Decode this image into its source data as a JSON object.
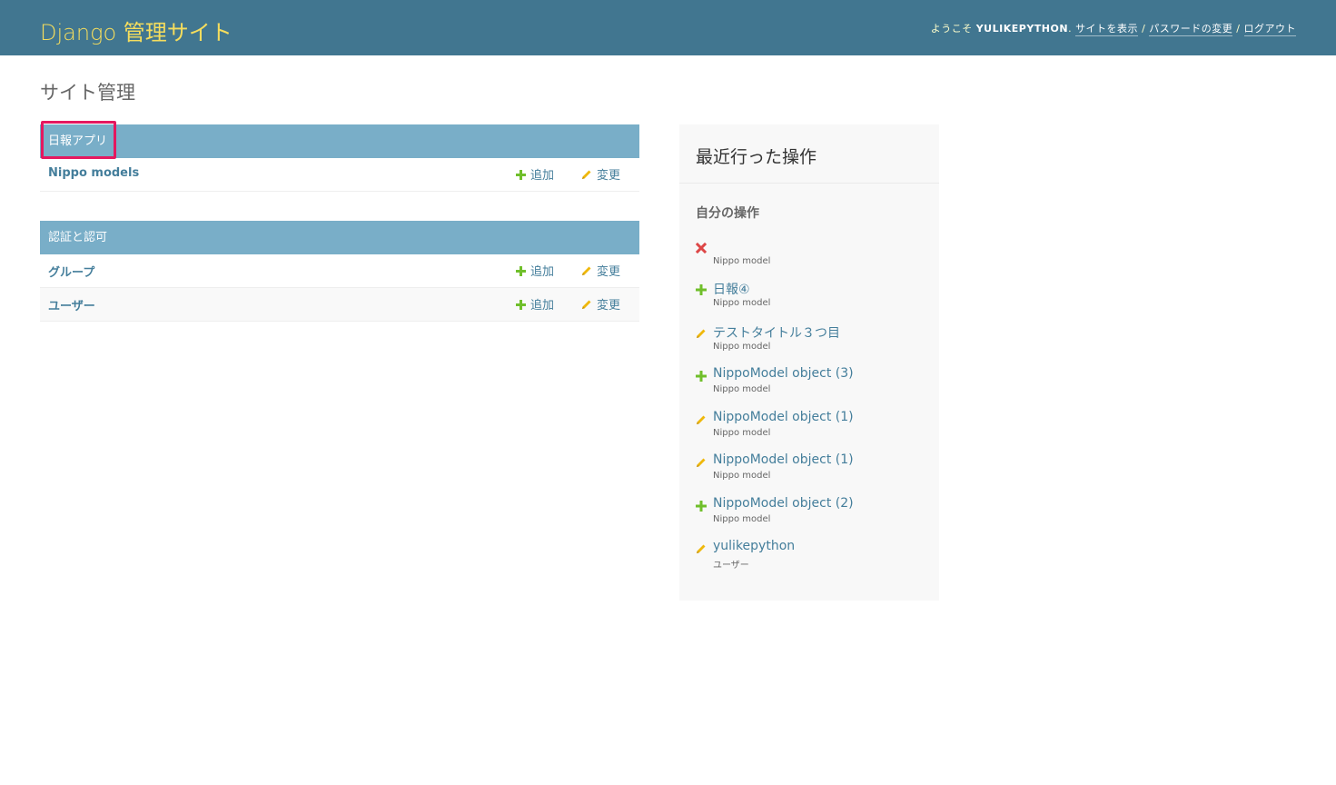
{
  "header": {
    "branding": "Django 管理サイト",
    "welcome": "ようこそ",
    "username": "YULIKEPYTHON",
    "view_site": "サイトを表示",
    "change_password": "パスワードの変更",
    "logout": "ログアウト",
    "separator": "/"
  },
  "page_title": "サイト管理",
  "apps": [
    {
      "caption": "日報アプリ",
      "models": [
        {
          "name": "Nippo models",
          "add": "追加",
          "change": "変更"
        }
      ]
    },
    {
      "caption": "認証と認可",
      "models": [
        {
          "name": "グループ",
          "add": "追加",
          "change": "変更"
        },
        {
          "name": "ユーザー",
          "add": "追加",
          "change": "変更"
        }
      ]
    }
  ],
  "recent_actions": {
    "title": "最近行った操作",
    "subtitle": "自分の操作",
    "items": [
      {
        "icon": "delete-icon",
        "label": "",
        "type": "Nippo model"
      },
      {
        "icon": "add-icon",
        "label": "日報④",
        "type": "Nippo model"
      },
      {
        "icon": "edit-icon",
        "label": "テストタイトル３つ目",
        "type": "Nippo model"
      },
      {
        "icon": "add-icon",
        "label": "NippoModel object (3)",
        "type": "Nippo model"
      },
      {
        "icon": "edit-icon",
        "label": "NippoModel object (1)",
        "type": "Nippo model"
      },
      {
        "icon": "edit-icon",
        "label": "NippoModel object (1)",
        "type": "Nippo model"
      },
      {
        "icon": "add-icon",
        "label": "NippoModel object (2)",
        "type": "Nippo model"
      },
      {
        "icon": "edit-icon",
        "label": "yulikepython",
        "type": "ユーザー"
      }
    ]
  },
  "colors": {
    "header_bg": "#417690",
    "branding": "#f5dd5d",
    "caption_bg": "#79aec8",
    "link": "#447e9b",
    "add_green": "#70bf2b",
    "edit_yellow": "#efb80b",
    "delete_red": "#dd4646",
    "highlight": "#e4185f"
  }
}
